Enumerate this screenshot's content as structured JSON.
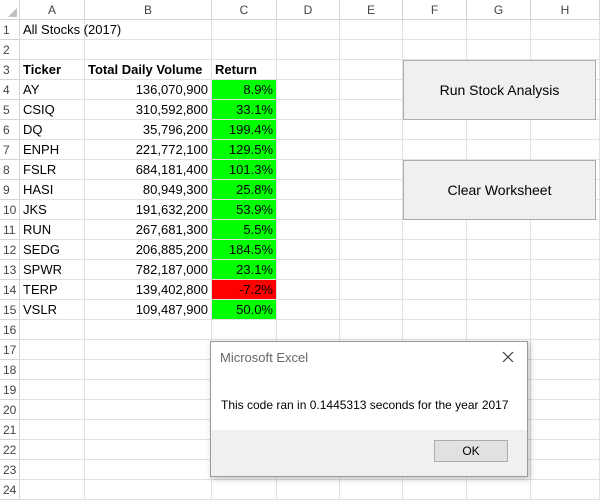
{
  "columns": [
    "A",
    "B",
    "C",
    "D",
    "E",
    "F",
    "G",
    "H"
  ],
  "rows": [
    "1",
    "2",
    "3",
    "4",
    "5",
    "6",
    "7",
    "8",
    "9",
    "10",
    "11",
    "12",
    "13",
    "14",
    "15",
    "16",
    "17",
    "18",
    "19",
    "20",
    "21",
    "22",
    "23",
    "24"
  ],
  "title": "All Stocks (2017)",
  "headers": {
    "ticker": "Ticker",
    "volume": "Total Daily Volume",
    "return": "Return"
  },
  "stocks": [
    {
      "ticker": "AY",
      "volume": "136,070,900",
      "return": "8.9%",
      "status": "positive"
    },
    {
      "ticker": "CSIQ",
      "volume": "310,592,800",
      "return": "33.1%",
      "status": "positive"
    },
    {
      "ticker": "DQ",
      "volume": "35,796,200",
      "return": "199.4%",
      "status": "positive"
    },
    {
      "ticker": "ENPH",
      "volume": "221,772,100",
      "return": "129.5%",
      "status": "positive"
    },
    {
      "ticker": "FSLR",
      "volume": "684,181,400",
      "return": "101.3%",
      "status": "positive"
    },
    {
      "ticker": "HASI",
      "volume": "80,949,300",
      "return": "25.8%",
      "status": "positive"
    },
    {
      "ticker": "JKS",
      "volume": "191,632,200",
      "return": "53.9%",
      "status": "positive"
    },
    {
      "ticker": "RUN",
      "volume": "267,681,300",
      "return": "5.5%",
      "status": "positive"
    },
    {
      "ticker": "SEDG",
      "volume": "206,885,200",
      "return": "184.5%",
      "status": "positive"
    },
    {
      "ticker": "SPWR",
      "volume": "782,187,000",
      "return": "23.1%",
      "status": "positive"
    },
    {
      "ticker": "TERP",
      "volume": "139,402,800",
      "return": "-7.2%",
      "status": "negative"
    },
    {
      "ticker": "VSLR",
      "volume": "109,487,900",
      "return": "50.0%",
      "status": "positive"
    }
  ],
  "buttons": {
    "run": "Run Stock Analysis",
    "clear": "Clear Worksheet"
  },
  "dialog": {
    "title": "Microsoft Excel",
    "message": "This code ran in 0.1445313 seconds for the year 2017",
    "ok": "OK"
  },
  "colors": {
    "positive": "#00ff00",
    "negative": "#ff0000",
    "grid": "#e1e1e1"
  }
}
